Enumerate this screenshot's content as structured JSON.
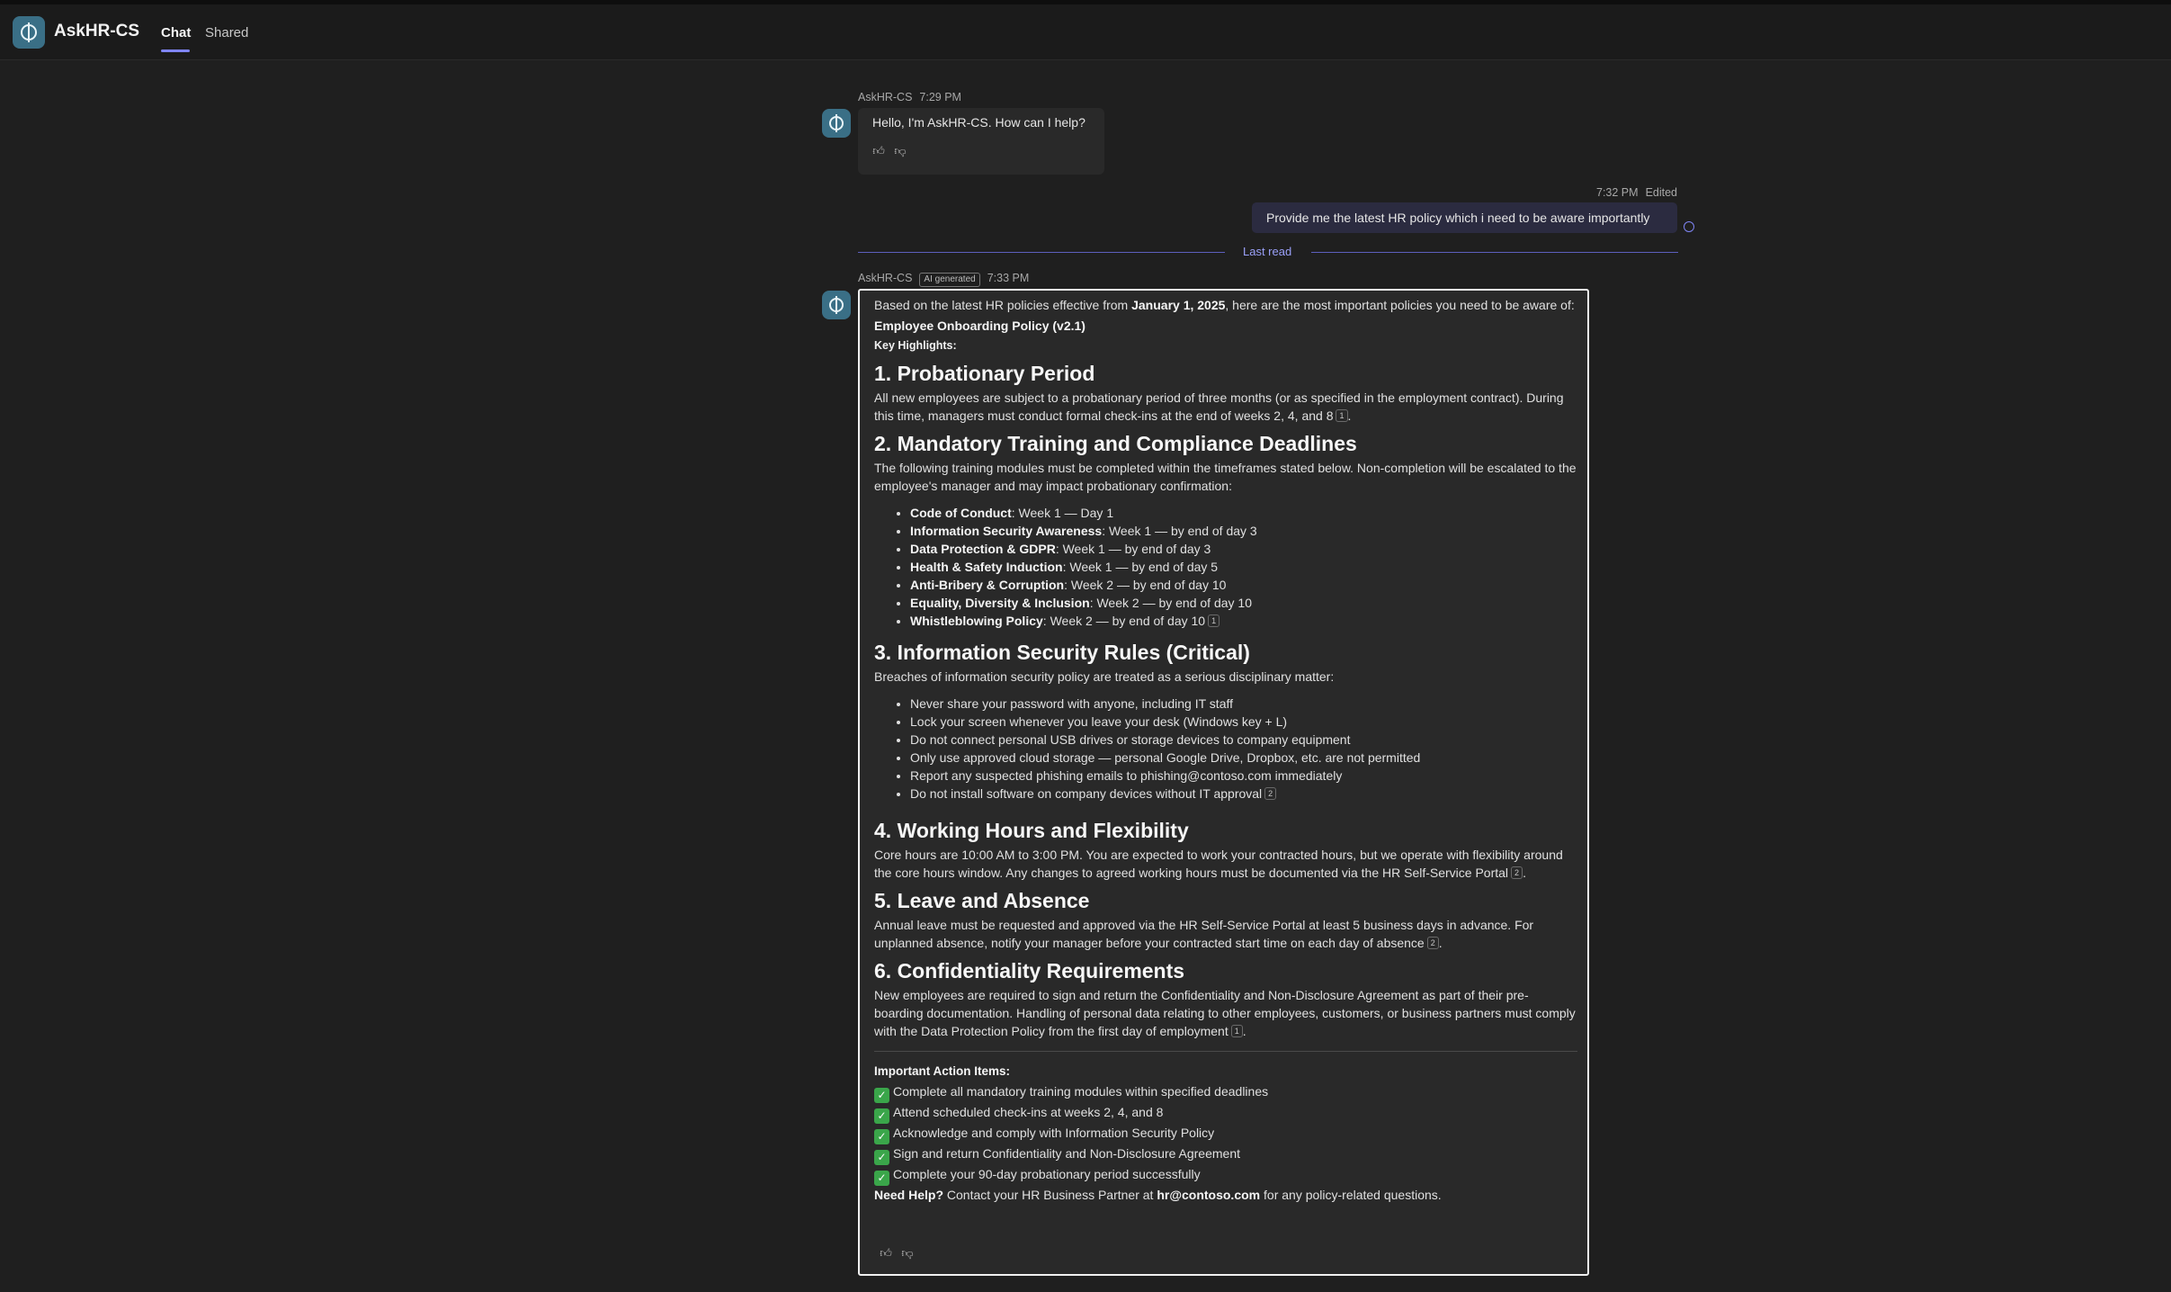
{
  "header": {
    "app_name": "AskHR-CS",
    "tabs": [
      {
        "label": "Chat"
      },
      {
        "label": "Shared"
      }
    ]
  },
  "messages": {
    "greeting": {
      "sender": "AskHR-CS",
      "time": "7:29 PM",
      "text": "Hello, I'm AskHR-CS. How can I help?"
    },
    "user": {
      "time": "7:32 PM",
      "edited": "Edited",
      "text": "Provide me the latest HR policy which i need to be aware importantly"
    },
    "divider_label": "Last read",
    "response": {
      "sender": "AskHR-CS",
      "badge": "AI generated",
      "time": "7:33 PM",
      "intro_before": "Based on the latest HR policies effective from ",
      "intro_bold": "January 1, 2025",
      "intro_after": ", here are the most important policies you need to be aware of:",
      "policy_title": "Employee Onboarding Policy (v2.1)",
      "key_highlights": "Key Highlights:",
      "s1_title": "1. Probationary Period",
      "s1_text": "All new employees are subject to a probationary period of three months (or as specified in the employment contract). During this time, managers must conduct formal check-ins at the end of weeks 2, 4, and 8",
      "s1_cite": "1",
      "s2_title": "2. Mandatory Training and Compliance Deadlines",
      "s2_text": "The following training modules must be completed within the timeframes stated below. Non-completion will be escalated to the employee's manager and may impact probationary confirmation:",
      "s2_items": [
        {
          "name": "Code of Conduct",
          "due": ": Week 1 — Day 1"
        },
        {
          "name": "Information Security Awareness",
          "due": ": Week 1 — by end of day 3"
        },
        {
          "name": "Data Protection & GDPR",
          "due": ": Week 1 — by end of day 3"
        },
        {
          "name": "Health & Safety Induction",
          "due": ": Week 1 — by end of day 5"
        },
        {
          "name": "Anti-Bribery & Corruption",
          "due": ": Week 2 — by end of day 10"
        },
        {
          "name": "Equality, Diversity & Inclusion",
          "due": ": Week 2 — by end of day 10"
        },
        {
          "name": "Whistleblowing Policy",
          "due": ": Week 2 — by end of day 10"
        }
      ],
      "s2_cite": "1",
      "s3_title": "3. Information Security Rules (Critical)",
      "s3_text": "Breaches of information security policy are treated as a serious disciplinary matter:",
      "s3_items": [
        "Never share your password with anyone, including IT staff",
        "Lock your screen whenever you leave your desk (Windows key + L)",
        "Do not connect personal USB drives or storage devices to company equipment",
        "Only use approved cloud storage — personal Google Drive, Dropbox, etc. are not permitted",
        "Report any suspected phishing emails to phishing@contoso.com immediately",
        "Do not install software on company devices without IT approval"
      ],
      "s3_cite": "2",
      "s4_title": "4. Working Hours and Flexibility",
      "s4_text": "Core hours are 10:00 AM to 3:00 PM. You are expected to work your contracted hours, but we operate with flexibility around the core hours window. Any changes to agreed working hours must be documented via the HR Self-Service Portal",
      "s4_cite": "2",
      "s5_title": "5. Leave and Absence",
      "s5_text": "Annual leave must be requested and approved via the HR Self-Service Portal at least 5 business days in advance. For unplanned absence, notify your manager before your contracted start time on each day of absence",
      "s5_cite": "2",
      "s6_title": "6. Confidentiality Requirements",
      "s6_text": "New employees are required to sign and return the Confidentiality and Non-Disclosure Agreement as part of their pre-boarding documentation. Handling of personal data relating to other employees, customers, or business partners must comply with the Data Protection Policy from the first day of employment",
      "s6_cite": "1",
      "actions_title": "Important Action Items:",
      "actions": [
        "Complete all mandatory training modules within specified deadlines",
        "Attend scheduled check-ins at weeks 2, 4, and 8",
        "Acknowledge and comply with Information Security Policy",
        "Sign and return Confidentiality and Non-Disclosure Agreement",
        "Complete your 90-day probationary period successfully"
      ],
      "help_label": "Need Help?",
      "help_before": " Contact your HR Business Partner at ",
      "help_email": "hr@contoso.com",
      "help_after": " for any policy-related questions."
    }
  }
}
